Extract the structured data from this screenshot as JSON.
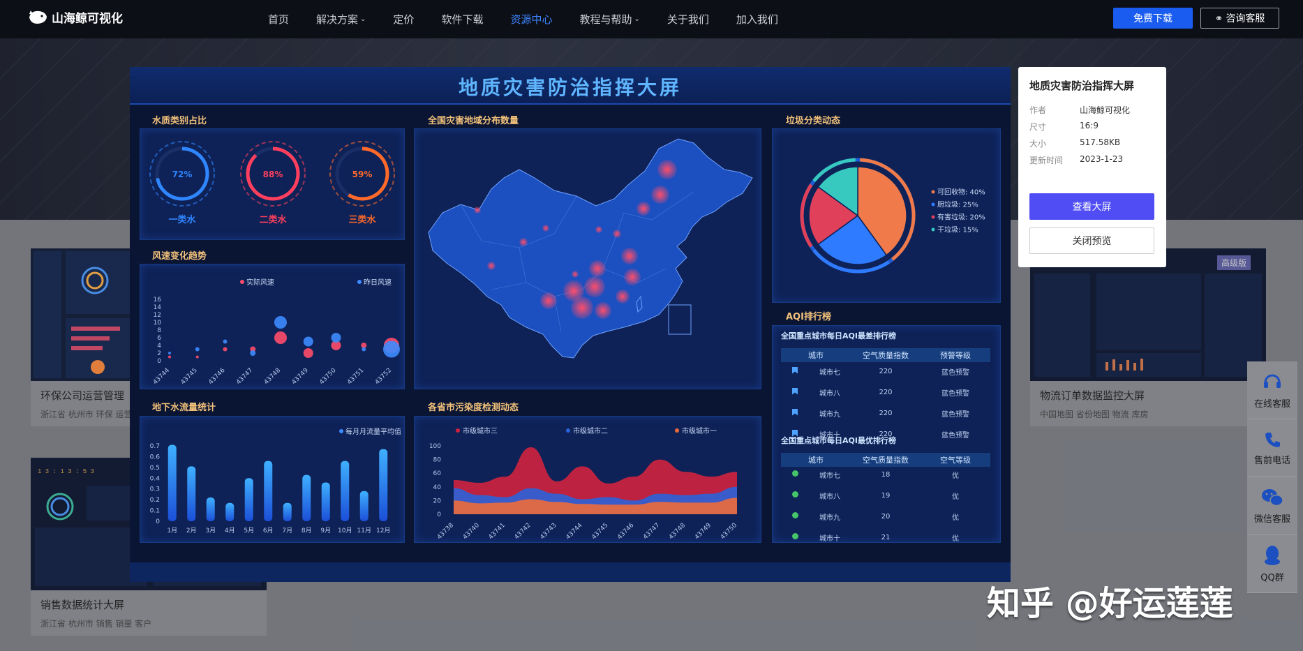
{
  "nav": {
    "logo": "山海鲸可视化",
    "items": [
      {
        "label": "首页",
        "dropdown": false,
        "active": false
      },
      {
        "label": "解决方案",
        "dropdown": true,
        "active": false
      },
      {
        "label": "定价",
        "dropdown": false,
        "active": false
      },
      {
        "label": "软件下载",
        "dropdown": false,
        "active": false
      },
      {
        "label": "资源中心",
        "dropdown": false,
        "active": true
      },
      {
        "label": "教程与帮助",
        "dropdown": true,
        "active": false
      },
      {
        "label": "关于我们",
        "dropdown": false,
        "active": false
      },
      {
        "label": "加入我们",
        "dropdown": false,
        "active": false
      }
    ],
    "download_label": "免费下载",
    "service_label": "咨询客服"
  },
  "cards": [
    {
      "title": "环保公司运营管理",
      "tags": "浙江省  杭州市  环保  运营"
    },
    {
      "title": "销售数据统计大屏",
      "tags": "浙江省  杭州市  销售  销量  客户"
    },
    {
      "title": "物流订单数据监控大屏",
      "tags": "中国地图  省份地图  物流  库房",
      "badge": "高级版"
    }
  ],
  "side_tools": [
    {
      "label": "在线客服",
      "icon": "headset-icon"
    },
    {
      "label": "售前电话",
      "icon": "phone-icon"
    },
    {
      "label": "微信客服",
      "icon": "wechat-icon"
    },
    {
      "label": "QQ群",
      "icon": "qq-icon"
    }
  ],
  "preview": {
    "title": "地质灾害防治指挥大屏",
    "panels": {
      "water_quality": {
        "title": "水质类别占比",
        "items": [
          {
            "label": "一类水",
            "value": "72%",
            "percent": 72,
            "color": "#2f86ff"
          },
          {
            "label": "二类水",
            "value": "88%",
            "percent": 88,
            "color": "#ff3f5d"
          },
          {
            "label": "三类水",
            "value": "59%",
            "percent": 59,
            "color": "#ff6a2a"
          }
        ]
      },
      "wind": {
        "title": "风速变化趋势",
        "legend": [
          "实际风速",
          "昨日风速"
        ]
      },
      "groundwater": {
        "title": "地下水流量统计",
        "legend": "每月月流量平均值"
      },
      "map": {
        "title": "全国灾害地域分布数量"
      },
      "pollution": {
        "title": "各省市污染度检测动态",
        "legend": [
          "市级城市三",
          "市级城市二",
          "市级城市一"
        ]
      },
      "garbage": {
        "title": "垃圾分类动态",
        "legend": [
          "可回收物: 40%",
          "厨垃圾: 25%",
          "有害垃圾: 20%",
          "干垃圾: 15%"
        ]
      },
      "aqi": {
        "title": "AQI排行榜",
        "worst": {
          "subtitle": "全国重点城市每日AQI最差排行榜",
          "headers": [
            "城市",
            "空气质量指数",
            "预警等级"
          ],
          "rows": [
            [
              "城市七",
              "220",
              "蓝色预警"
            ],
            [
              "城市八",
              "220",
              "蓝色预警"
            ],
            [
              "城市九",
              "220",
              "蓝色预警"
            ],
            [
              "城市十",
              "220",
              "蓝色预警"
            ]
          ]
        },
        "best": {
          "subtitle": "全国重点城市每日AQI最优排行榜",
          "headers": [
            "城市",
            "空气质量指数",
            "空气等级"
          ],
          "rows": [
            [
              "城市七",
              "18",
              "优"
            ],
            [
              "城市八",
              "19",
              "优"
            ],
            [
              "城市九",
              "20",
              "优"
            ],
            [
              "城市十",
              "21",
              "优"
            ]
          ]
        }
      }
    }
  },
  "info": {
    "title": "地质灾害防治指挥大屏",
    "rows": [
      {
        "key": "作者",
        "value": "山海鲸可视化"
      },
      {
        "key": "尺寸",
        "value": "16:9"
      },
      {
        "key": "大小",
        "value": "517.58KB"
      },
      {
        "key": "更新时间",
        "value": "2023-1-23"
      }
    ],
    "view_label": "查看大屏",
    "close_label": "关闭预览"
  },
  "watermark": "知乎 @好运莲莲",
  "chart_data": [
    {
      "type": "scatter",
      "title": "风速变化趋势",
      "x": [
        "43744",
        "43745",
        "43746",
        "43747",
        "43748",
        "43749",
        "43750",
        "43751",
        "43752"
      ],
      "yticks": [
        0,
        2,
        4,
        6,
        8,
        10,
        12,
        14,
        16
      ],
      "ylim": [
        0,
        16
      ],
      "series": [
        {
          "name": "实际风速",
          "color": "#ff4d6a",
          "values": [
            1,
            1,
            3,
            3,
            6,
            2,
            4,
            4,
            4
          ],
          "sizes": [
            2,
            2,
            3,
            4,
            9,
            7,
            7,
            4,
            11
          ]
        },
        {
          "name": "昨日风速",
          "color": "#3d8bff",
          "values": [
            2,
            3,
            5,
            2,
            10,
            5,
            6,
            3,
            3
          ],
          "sizes": [
            2,
            3,
            3,
            4,
            9,
            7,
            7,
            3,
            12
          ]
        }
      ]
    },
    {
      "type": "bar",
      "title": "地下水流量统计",
      "categories": [
        "1月",
        "2月",
        "3月",
        "4月",
        "5月",
        "6月",
        "7月",
        "8月",
        "9月",
        "10月",
        "11月",
        "12月"
      ],
      "yticks": [
        0,
        0.1,
        0.2,
        0.3,
        0.4,
        0.5,
        0.6,
        0.7
      ],
      "ylim": [
        0,
        0.7
      ],
      "series": [
        {
          "name": "每月月流量平均值",
          "values": [
            0.71,
            0.51,
            0.22,
            0.17,
            0.4,
            0.56,
            0.17,
            0.43,
            0.36,
            0.56,
            0.28,
            0.67
          ]
        }
      ]
    },
    {
      "type": "area",
      "title": "各省市污染度检测动态",
      "x": [
        "43738",
        "43740",
        "43741",
        "43742",
        "43743",
        "43744",
        "43745",
        "43746",
        "43747",
        "43748",
        "43749",
        "43750"
      ],
      "yticks": [
        0,
        20,
        40,
        60,
        80,
        100
      ],
      "ylim": [
        0,
        100
      ],
      "series": [
        {
          "name": "市级城市三",
          "color": "#d0233f",
          "values": [
            50,
            46,
            55,
            98,
            48,
            70,
            45,
            55,
            80,
            62,
            55,
            62
          ]
        },
        {
          "name": "市级城市二",
          "color": "#2a63d9",
          "values": [
            38,
            28,
            25,
            38,
            30,
            22,
            25,
            20,
            30,
            28,
            30,
            40
          ]
        },
        {
          "name": "市级城市一",
          "color": "#ee6a3a",
          "values": [
            20,
            16,
            17,
            22,
            18,
            15,
            14,
            14,
            18,
            17,
            17,
            24
          ]
        }
      ]
    },
    {
      "type": "pie",
      "title": "垃圾分类动态",
      "labels": [
        "可回收物",
        "厨垃圾",
        "有害垃圾",
        "干垃圾"
      ],
      "values": [
        40,
        25,
        20,
        15
      ],
      "colors": [
        "#f07a4a",
        "#2f7bff",
        "#e0405a",
        "#37c8c0"
      ]
    }
  ]
}
